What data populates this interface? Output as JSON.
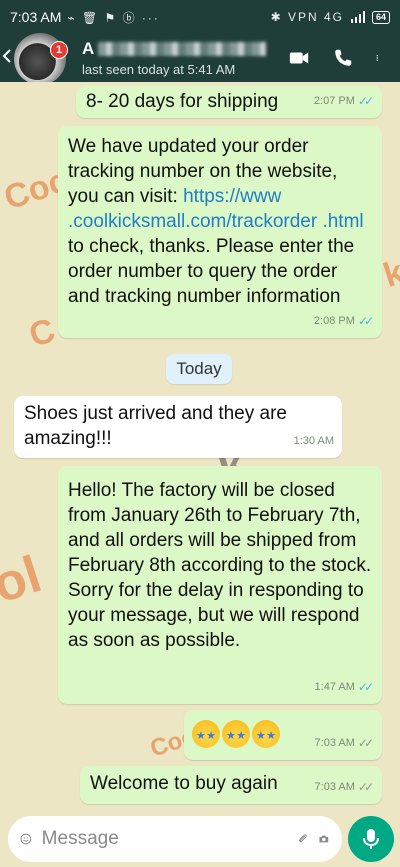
{
  "status_bar": {
    "time": "7:03 AM",
    "left_icons": "⌁ 🗑 ⚑ ⓑ ···",
    "right_icons": "✱ VPN 4G",
    "battery": "64"
  },
  "header": {
    "unread_count": "1",
    "contact_initial": "A",
    "last_seen": "last seen today at 5:41 AM"
  },
  "messages": [
    {
      "text": "8- 20 days for shipping",
      "time": "2:07 PM"
    },
    {
      "text_before_link": "We have updated your order tracking number on the website, you can visit: ",
      "link": "https://www .coolkicksmall.com/trackorder .html",
      "text_after_link": " to check, thanks. Please enter the order number to query the order and tracking number information",
      "time": "2:08 PM"
    },
    {
      "text": "Shoes just arrived and they are amazing!!!",
      "time": "1:30 AM"
    },
    {
      "text": "Hello! The factory will be closed from January 26th to February 7th, and all orders will be shipped from February 8th according to the stock. Sorry for the delay in responding to your message, but we will respond as soon as possible.",
      "time": "1:47 AM"
    },
    {
      "emoji": "star-struck x3",
      "time": "7:03 AM"
    },
    {
      "text": "Welcome to buy again",
      "time": "7:03 AM"
    }
  ],
  "date_chip": "Today",
  "composer": {
    "placeholder": "Message"
  },
  "colors": {
    "header": "#1f3d39",
    "outgoing_bubble": "#dcf8c6",
    "incoming_bubble": "#ffffff",
    "read_tick": "#4fb3f0",
    "send_button": "#00a884"
  }
}
